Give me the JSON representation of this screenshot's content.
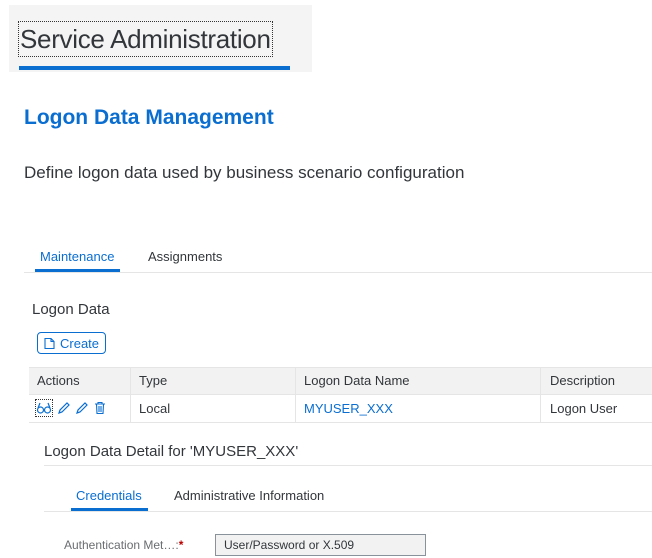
{
  "header": {
    "service_tab": "Service Administration"
  },
  "page": {
    "title": "Logon Data Management",
    "subtitle": "Define logon data used by business scenario configuration"
  },
  "tabs": [
    {
      "label": "Maintenance",
      "selected": true
    },
    {
      "label": "Assignments",
      "selected": false
    }
  ],
  "logon_data": {
    "section_title": "Logon Data",
    "create_label": "Create",
    "columns": [
      "Actions",
      "Type",
      "Logon Data Name",
      "Description"
    ],
    "rows": [
      {
        "actions": [
          "display-icon",
          "edit-icon",
          "edit-icon",
          "delete-icon"
        ],
        "type": "Local",
        "name": "MYUSER_XXX",
        "description": "Logon User"
      }
    ]
  },
  "detail": {
    "title": "Logon Data Detail for 'MYUSER_XXX'",
    "tabs": [
      {
        "label": "Credentials",
        "selected": true
      },
      {
        "label": "Administrative Information",
        "selected": false
      }
    ],
    "auth_label": "Authentication Met…:",
    "auth_required_mark": "*",
    "auth_value": "User/Password or X.509"
  },
  "colors": {
    "accent": "#0a6ed1",
    "text": "#32363a",
    "required": "#bb0000"
  }
}
